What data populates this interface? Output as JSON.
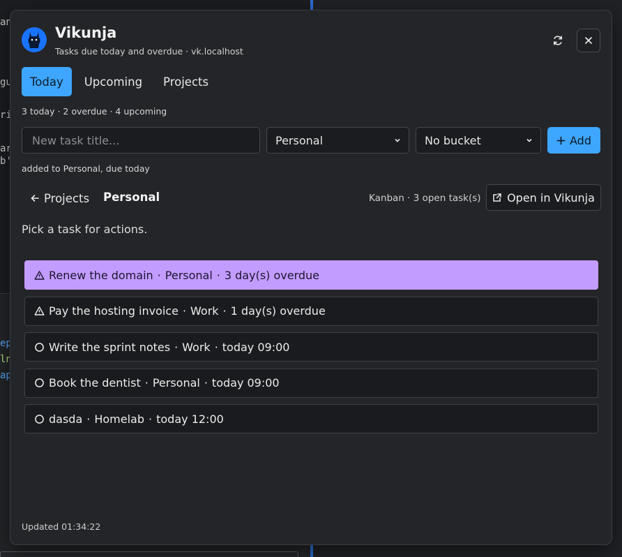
{
  "app": {
    "title": "Vikunja",
    "subtitle": "Tasks due today and overdue · vk.localhost",
    "logo_icon": "vikunja-llama-icon",
    "accent": "#3ea6ff",
    "selected_color": "#c39cff"
  },
  "tabs": [
    {
      "label": "Today",
      "active": true
    },
    {
      "label": "Upcoming",
      "active": false
    },
    {
      "label": "Projects",
      "active": false
    }
  ],
  "counts_text": "3 today · 2 overdue · 4 upcoming",
  "new_task": {
    "placeholder": "New task title...",
    "value": "",
    "project": "Personal",
    "bucket": "No bucket",
    "add_label": "Add"
  },
  "status_message": "added to Personal, due today",
  "project_view": {
    "back_label": "Projects",
    "project_name": "Personal",
    "info": "Kanban · 3 open task(s)",
    "open_label": "Open in Vikunja",
    "hint": "Pick a task for actions."
  },
  "tasks": [
    {
      "title": "Renew the domain",
      "project": "Personal",
      "due": "3 day(s) overdue",
      "status_icon": "warning-icon",
      "selected": true
    },
    {
      "title": "Pay the hosting invoice",
      "project": "Work",
      "due": "1 day(s) overdue",
      "status_icon": "warning-icon",
      "selected": false
    },
    {
      "title": "Write the sprint notes",
      "project": "Work",
      "due": "today 09:00",
      "status_icon": "circle-icon",
      "selected": false
    },
    {
      "title": "Book the dentist",
      "project": "Personal",
      "due": "today 09:00",
      "status_icon": "circle-icon",
      "selected": false
    },
    {
      "title": "dasda",
      "project": "Homelab",
      "due": "today 12:00",
      "status_icon": "circle-icon",
      "selected": false
    }
  ],
  "separator": "·",
  "footer": {
    "updated": "Updated 01:34:22"
  },
  "background": {
    "fragments": [
      "an",
      "gu",
      "rin",
      "ar",
      "b'(",
      "ep",
      "ln",
      "ap."
    ]
  }
}
